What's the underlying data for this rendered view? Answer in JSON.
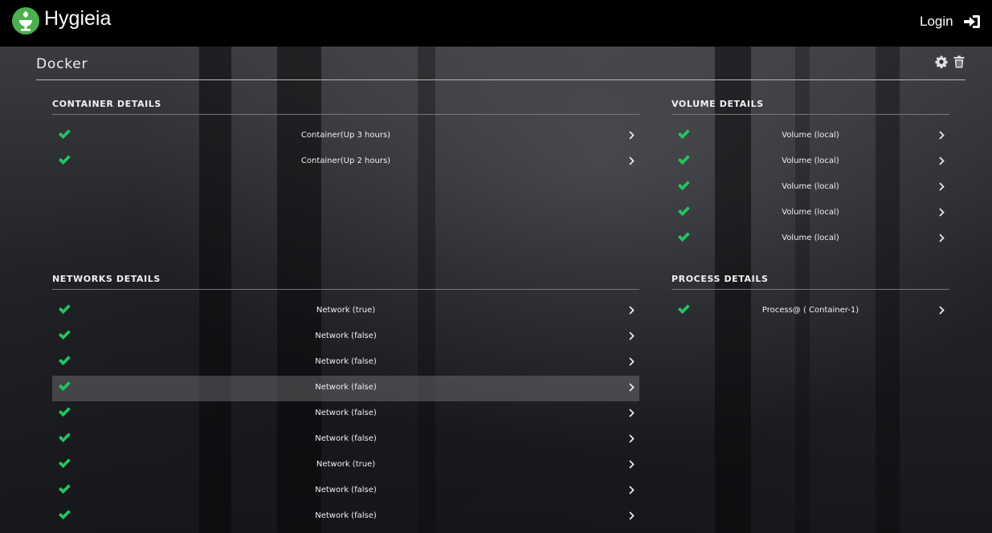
{
  "header": {
    "brand": "Hygieia",
    "login_label": "Login"
  },
  "page": {
    "title": "Docker"
  },
  "colors": {
    "check": "#22c55e",
    "header_bg": "#000000",
    "logo_green": "#4caf50"
  },
  "icons": {
    "settings": "gear-icon",
    "delete": "trash-icon",
    "login": "sign-in-icon",
    "status": "check-icon",
    "open": "chevron-right-icon"
  },
  "sections": {
    "container": {
      "heading": "CONTAINER DETAILS",
      "items": [
        "Container(Up 3 hours)",
        "Container(Up 2 hours)"
      ]
    },
    "volume": {
      "heading": "VOLUME DETAILS",
      "items": [
        "Volume (local)",
        "Volume (local)",
        "Volume (local)",
        "Volume (local)",
        "Volume (local)"
      ]
    },
    "networks": {
      "heading": "NETWORKS DETAILS",
      "items": [
        "Network (true)",
        "Network (false)",
        "Network (false)",
        "Network (false)",
        "Network (false)",
        "Network (false)",
        "Network (true)",
        "Network (false)",
        "Network (false)"
      ],
      "selected_index": 3
    },
    "process": {
      "heading": "PROCESS DETAILS",
      "items": [
        "Process@ ( Container-1)"
      ]
    }
  }
}
